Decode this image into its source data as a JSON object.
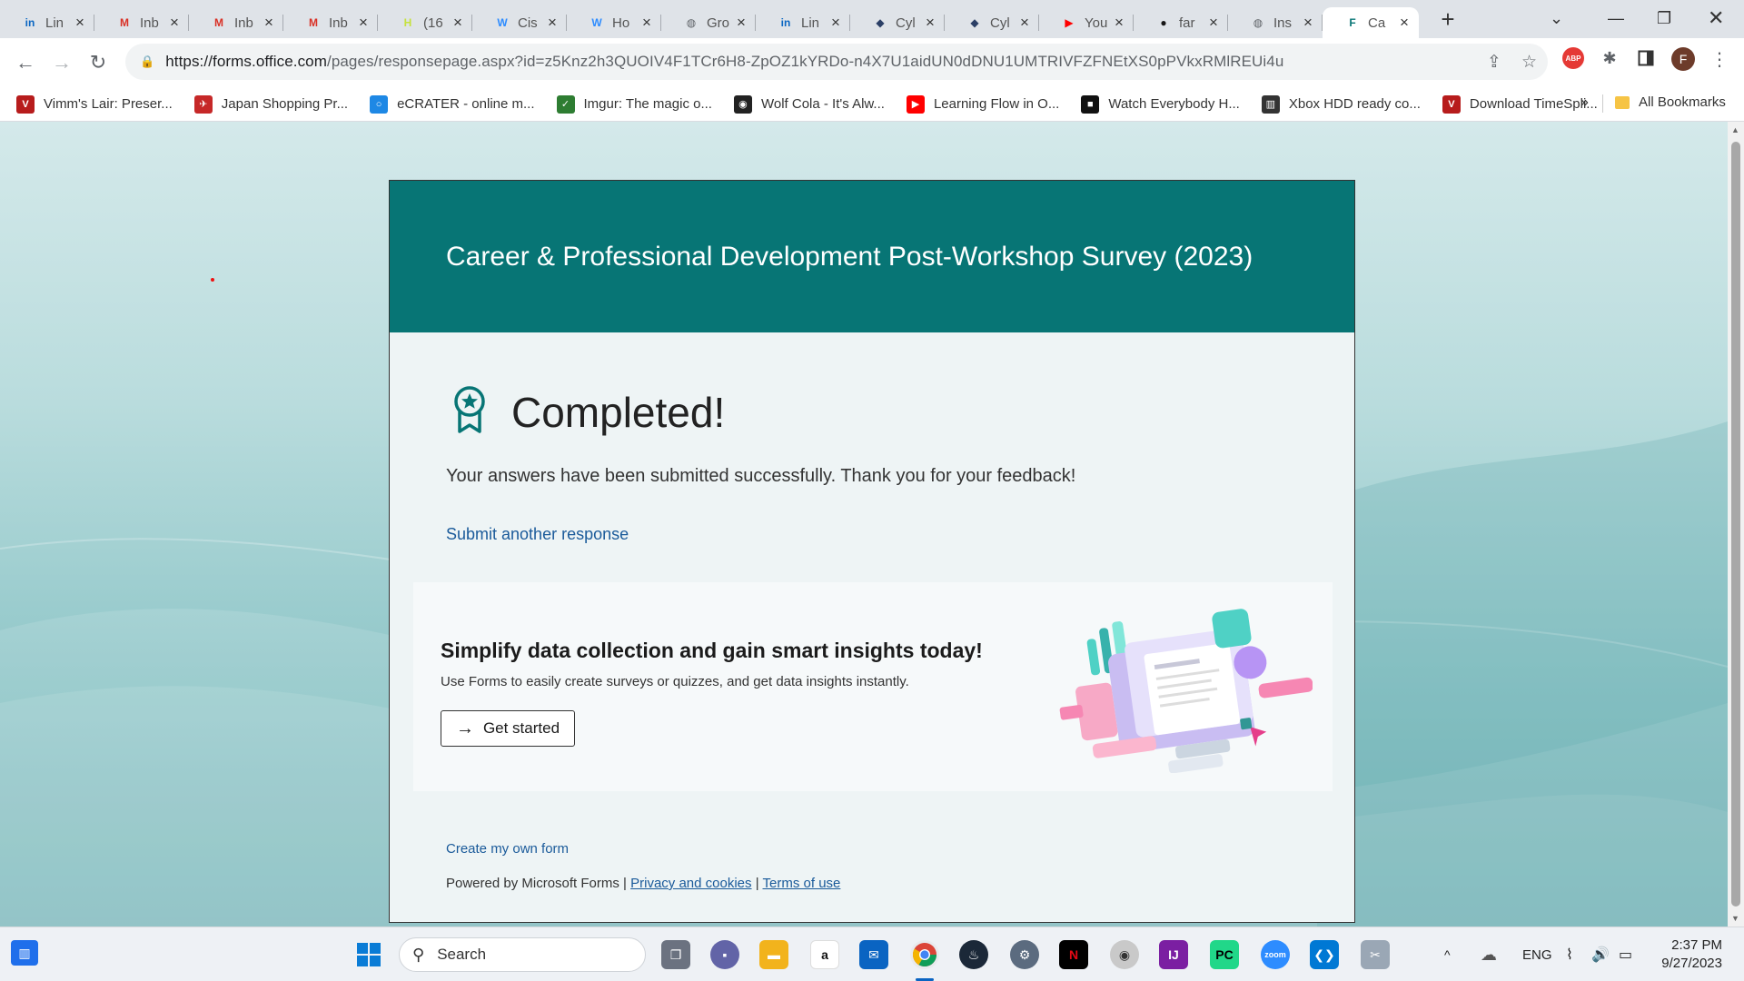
{
  "browser": {
    "tabs": [
      {
        "icon": "linkedin-icon",
        "glyph": "in",
        "color": "#0a66c2",
        "label": "Lin"
      },
      {
        "icon": "gmail-icon",
        "glyph": "M",
        "color": "#d93025",
        "label": "Inb"
      },
      {
        "icon": "gmail-icon",
        "glyph": "M",
        "color": "#d93025",
        "label": "Inb"
      },
      {
        "icon": "gmail-icon",
        "glyph": "M",
        "color": "#d93025",
        "label": "Inb"
      },
      {
        "icon": "handshake-icon",
        "glyph": "H",
        "color": "#c5e23d",
        "label": "(16"
      },
      {
        "icon": "cisco-icon",
        "glyph": "W",
        "color": "#2d8cff",
        "label": "Cis"
      },
      {
        "icon": "webex-icon",
        "glyph": "W",
        "color": "#2d8cff",
        "label": "Ho"
      },
      {
        "icon": "globe-icon",
        "glyph": "◍",
        "color": "#5f6368",
        "label": "Gro"
      },
      {
        "icon": "linkedin-icon",
        "glyph": "in",
        "color": "#0a66c2",
        "label": "Lin"
      },
      {
        "icon": "cyber-icon",
        "glyph": "◆",
        "color": "#2b3f66",
        "label": "Cyl"
      },
      {
        "icon": "cyber-icon",
        "glyph": "◆",
        "color": "#2b3f66",
        "label": "Cyl"
      },
      {
        "icon": "youtube-icon",
        "glyph": "▶",
        "color": "#ff0000",
        "label": "You"
      },
      {
        "icon": "github-icon",
        "glyph": "●",
        "color": "#181717",
        "label": "far"
      },
      {
        "icon": "globe-icon",
        "glyph": "◍",
        "color": "#5f6368",
        "label": "Ins"
      },
      {
        "icon": "forms-icon",
        "glyph": "F",
        "color": "#077575",
        "label": "Ca",
        "active": true
      }
    ],
    "url_host": "https://forms.office.com",
    "url_path": "/pages/responsepage.aspx?id=z5Knz2h3QUOIV4F1TCr6H8-ZpOZ1kYRDo-n4X7U1aidUN0dDNU1UMTRIVFZFNEtXS0pPVkxRMlREUi4u",
    "profile_initial": "F",
    "abp_label": "ABP",
    "bookmarks": [
      {
        "icon": "vimm-icon",
        "color": "#b71c1c",
        "glyph": "V",
        "label": "Vimm's Lair: Preser..."
      },
      {
        "icon": "japan-shopping-icon",
        "color": "#c62828",
        "glyph": "✈",
        "label": "Japan Shopping Pr..."
      },
      {
        "icon": "ecrater-icon",
        "color": "#1e88e5",
        "glyph": "○",
        "label": "eCRATER - online m..."
      },
      {
        "icon": "imgur-icon",
        "color": "#2e7d32",
        "glyph": "✓",
        "label": "Imgur: The magic o..."
      },
      {
        "icon": "wolf-cola-icon",
        "color": "#222222",
        "glyph": "◉",
        "label": "Wolf Cola - It's Alw..."
      },
      {
        "icon": "youtube-icon",
        "color": "#ff0000",
        "glyph": "▶",
        "label": "Learning Flow in O..."
      },
      {
        "icon": "camera-icon",
        "color": "#111111",
        "glyph": "■",
        "label": "Watch Everybody H..."
      },
      {
        "icon": "xbox-icon",
        "color": "#333333",
        "glyph": "▥",
        "label": "Xbox HDD ready co..."
      },
      {
        "icon": "vimm-icon",
        "color": "#b71c1c",
        "glyph": "V",
        "label": "Download TimeSpli..."
      }
    ],
    "more_bookmarks": "»",
    "all_bookmarks": "All Bookmarks"
  },
  "form": {
    "title": "Career & Professional Development Post-Workshop Survey (2023)",
    "completed": "Completed!",
    "message": "Your answers have been submitted successfully. Thank you for your feedback!",
    "submit_another": "Submit another response",
    "promo_title": "Simplify data collection and gain smart insights today!",
    "promo_sub": "Use Forms to easily create surveys or quizzes, and get data insights instantly.",
    "get_started": "Get started",
    "create_own": "Create my own form",
    "powered_by": "Powered by Microsoft Forms |",
    "privacy": "Privacy and cookies",
    "separator": "|",
    "terms": "Terms of use"
  },
  "taskbar": {
    "search_placeholder": "Search",
    "language": "ENG",
    "time": "2:37 PM",
    "date": "9/27/2023"
  },
  "colors": {
    "header": "#077575",
    "link": "#1a5a9a"
  }
}
